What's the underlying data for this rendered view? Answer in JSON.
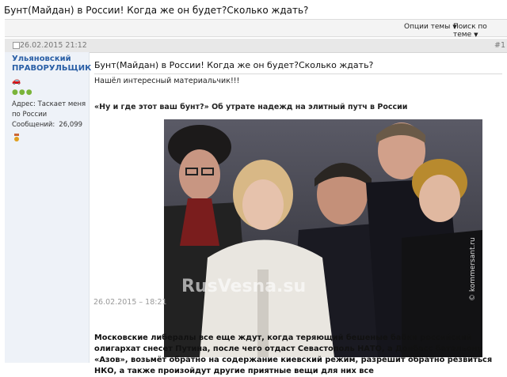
{
  "thread": {
    "title": "Бунт(Майдан) в России! Когда же он будет?Сколько ждать?"
  },
  "toolbar": {
    "thread_options": "Опции темы",
    "search_thread": "Поиск по теме"
  },
  "post": {
    "date": "26.02.2015 21:12",
    "number": "#1",
    "author": {
      "name": "Ульяновский ПРАВОРУЛЬЩИК",
      "address_label": "Адрес:",
      "address_value": "Таскает меня по России",
      "messages_label": "Сообщений:",
      "messages_value": "26,099"
    },
    "title": "Бунт(Майдан) в России! Когда же он будет?Сколько ждать?",
    "intro": "Нашёл интересный материальчик!!!",
    "headline": "«Ну и где этот ваш бунт?» Об утрате надежд на элитный путч в России",
    "photo_watermark": "RusVesna.su",
    "photo_credit": "© kommersant.ru",
    "article_date": "26.02.2015 – 18:21",
    "body": "Московские либералы все еще ждут, когда теряющий бешеные бабки российский олигархат снесет Путина, после чего отдаст Севастополь НАТО, а Донбасс батальону «Азов», возьмёт обратно на содержание киевский режим, разрешит обратно резвиться НКО, а также произойдут другие приятные вещи для них все"
  },
  "colors": {
    "username": "#2a5fa6",
    "userpane_bg": "#eef2f8",
    "postbar_bg": "#e8e8e8"
  }
}
